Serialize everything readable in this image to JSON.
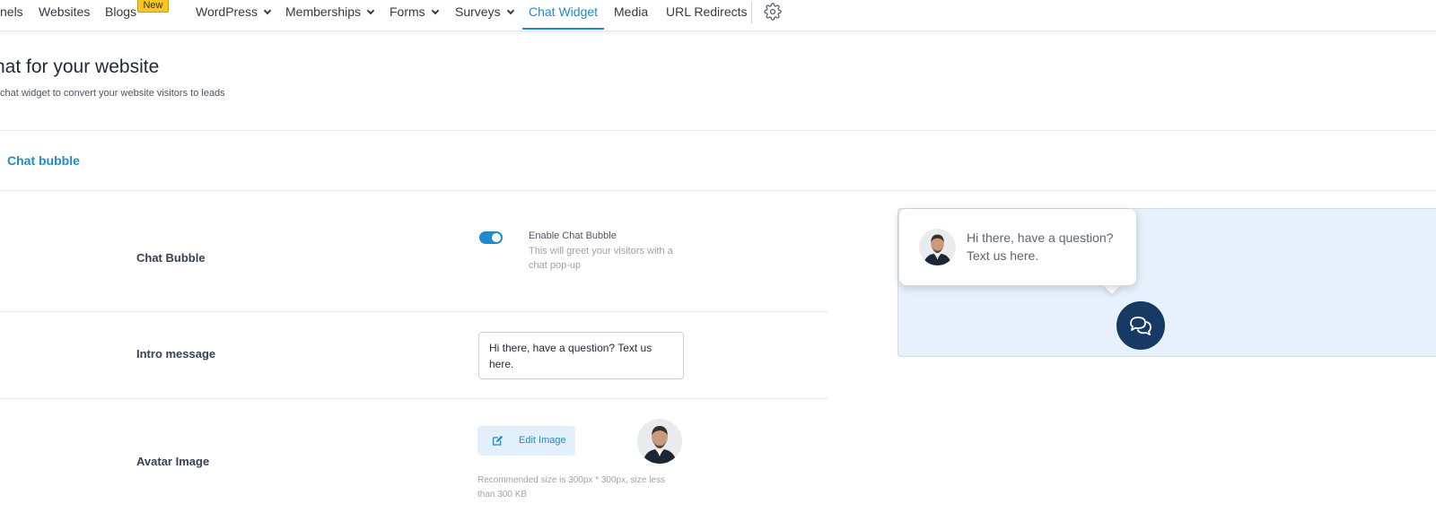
{
  "nav": {
    "items": [
      {
        "label": "nels",
        "dropdown": false,
        "active": false
      },
      {
        "label": "Websites",
        "dropdown": false,
        "active": false
      },
      {
        "label": "Blogs",
        "dropdown": false,
        "active": false,
        "badge": "New"
      },
      {
        "label": "WordPress",
        "dropdown": true,
        "active": false
      },
      {
        "label": "Memberships",
        "dropdown": true,
        "active": false
      },
      {
        "label": "Forms",
        "dropdown": true,
        "active": false
      },
      {
        "label": "Surveys",
        "dropdown": true,
        "active": false
      },
      {
        "label": "Chat Widget",
        "dropdown": false,
        "active": true
      },
      {
        "label": "Media",
        "dropdown": false,
        "active": false
      },
      {
        "label": "URL Redirects",
        "dropdown": false,
        "active": false
      }
    ],
    "settings_icon": "gear-icon"
  },
  "header": {
    "title": "hat for your website",
    "subtitle": "chat widget to convert your website visitors to leads"
  },
  "section_tab": "Chat bubble",
  "form": {
    "chat_bubble": {
      "label": "Chat Bubble",
      "toggle_on": true,
      "toggle_title": "Enable Chat Bubble",
      "toggle_description": "This will greet your visitors with a chat pop-up"
    },
    "intro_message": {
      "label": "Intro message",
      "value": "Hi there, have a question? Text us here."
    },
    "avatar": {
      "label": "Avatar Image",
      "edit_button": "Edit Image",
      "recommendation": "Recommended size is 300px * 300px, size less than 300 KB"
    }
  },
  "preview": {
    "bubble_text": "Hi there, have a question? Text us here.",
    "launcher_icon": "chat-bubbles-icon"
  },
  "colors": {
    "accent": "#1c8ccd",
    "launcher": "#163a64",
    "preview_bg": "#e6f1fc",
    "badge": "#f8c522"
  }
}
